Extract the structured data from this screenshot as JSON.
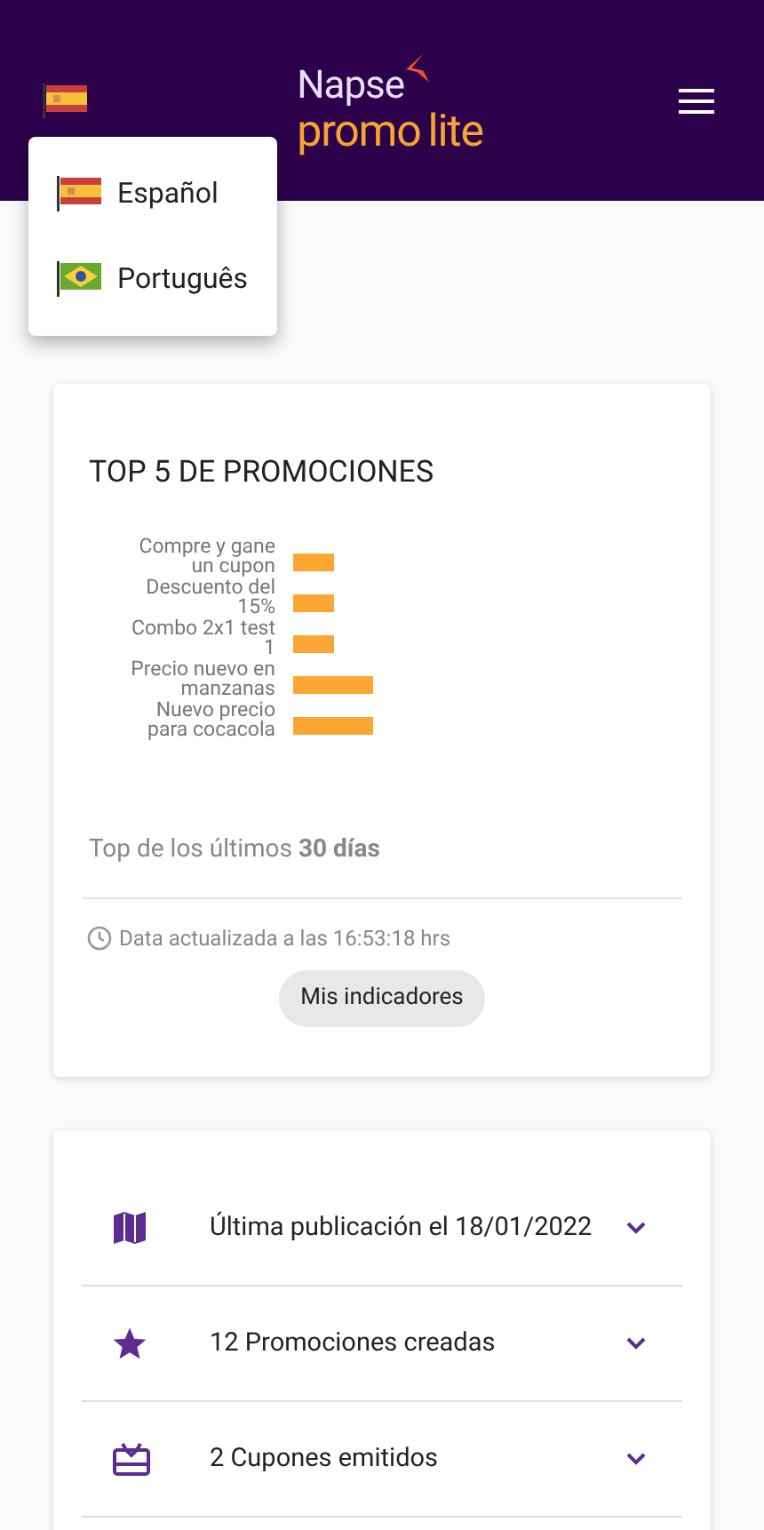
{
  "header": {
    "logo_top": "Napse",
    "logo_promo": "promo",
    "logo_lite": "lite"
  },
  "language_menu": {
    "items": [
      {
        "label": "Español",
        "kind": "es"
      },
      {
        "label": "Português",
        "kind": "br"
      }
    ]
  },
  "top_card": {
    "title": "TOP 5 DE PROMOCIONES",
    "bar_labels": [
      "Compre y gane un cupon",
      "Descuento del 15%",
      "Combo 2x1 test 1",
      "Precio nuevo en manzanas",
      "Nuevo precio para cocacola"
    ],
    "period": "Top de los últimos **30 días**",
    "updated": "Data actualizada a las 16:53:18 hrs",
    "button": "Mis indicadores"
  },
  "summary": [
    {
      "kind": "map",
      "text": "Última publicación el 18/01/2022"
    },
    {
      "kind": "star",
      "text": "12 Promociones creadas"
    },
    {
      "kind": "gift",
      "text": "2 Cupones emitidos"
    }
  ]
}
